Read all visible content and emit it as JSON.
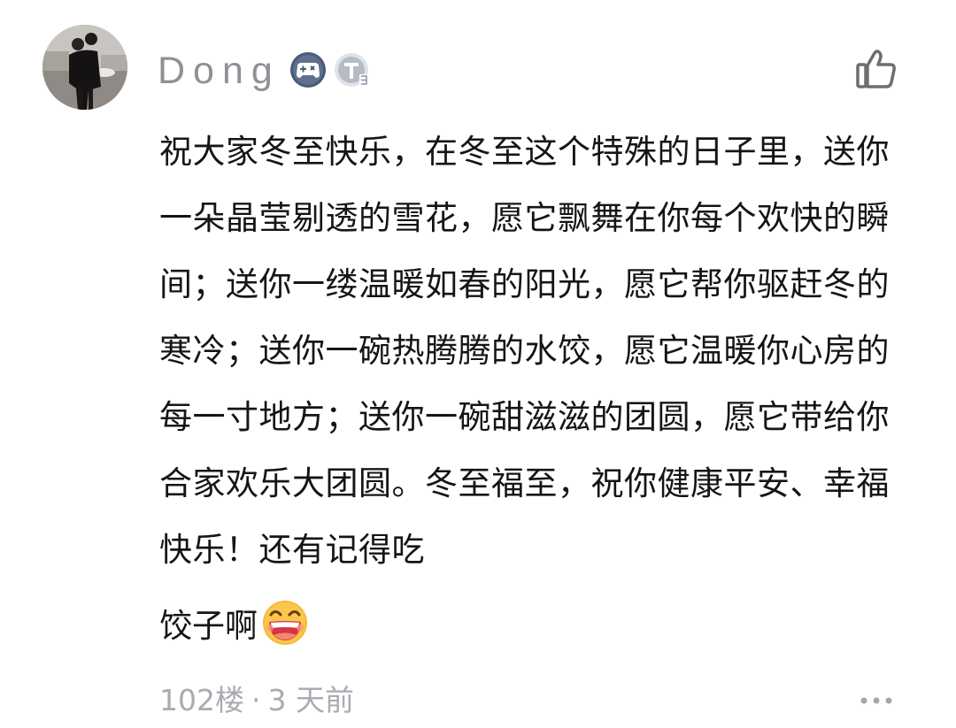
{
  "comment": {
    "user": {
      "name": "Dong",
      "avatar": "avatar-photo",
      "badges": [
        {
          "icon": "gamepad-icon",
          "color": "#4a5a78"
        },
        {
          "icon": "level-t-icon",
          "color": "#b5bcc6"
        }
      ]
    },
    "like_icon": "thumbs-up-icon",
    "text": "祝大家冬至快乐，在冬至这个特殊的日子里，送你一朵晶莹剔透的雪花，愿它飘舞在你每个欢快的瞬间；送你一缕温暖如春的阳光，愿它帮你驱赶冬的寒冷；送你一碗热腾腾的水饺，愿它温暖你心房的每一寸地方；送你一碗甜滋滋的团圆，愿它带给你合家欢乐大团圆。冬至福至，祝你健康平安、幸福快乐！还有记得吃",
    "last_line": "饺子啊",
    "emoji": "grinning-face-emoji",
    "floor": "102楼",
    "time": "3 天前",
    "separator": "·",
    "more_icon": "more-dots-icon"
  },
  "colors": {
    "text": "#151515",
    "meta": "#a8abb0",
    "username": "#8e9196"
  }
}
